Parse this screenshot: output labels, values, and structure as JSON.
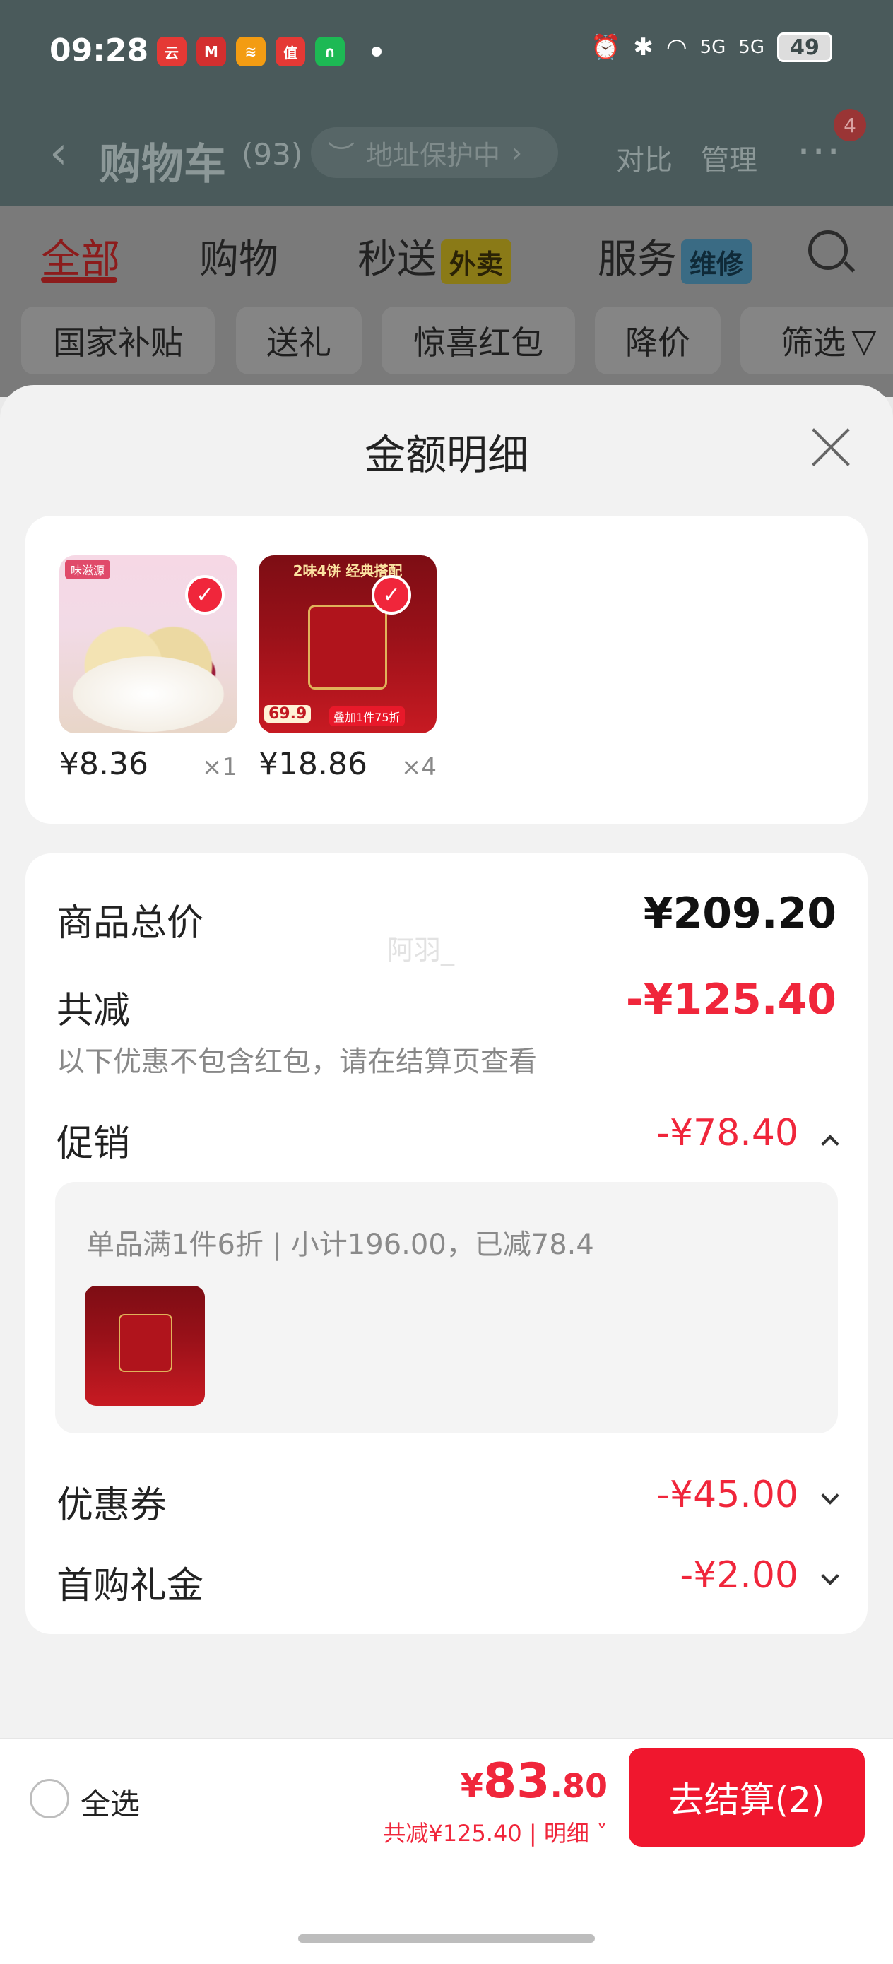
{
  "status_bar": {
    "time": "09:28",
    "apps": [
      {
        "icon": "yunshanfu-app-icon",
        "label": "云闪付",
        "color": "#e53935"
      },
      {
        "icon": "cmb-app-icon",
        "label": "M",
        "color": "#d32f2f"
      },
      {
        "icon": "pinduoduo-app-icon",
        "label": "≋",
        "color": "#f39c12"
      },
      {
        "icon": "smzdm-app-icon",
        "label": "值",
        "color": "#e53935"
      },
      {
        "icon": "fuli-app-icon",
        "label": "∩",
        "color": "#1db954"
      }
    ],
    "battery": "49",
    "network": "5G"
  },
  "navbar": {
    "back": "‹",
    "title": "购物车",
    "count": "(93)",
    "address_protect": "地址保护中",
    "compare": "对比",
    "manage": "管理",
    "more": "···",
    "badge": "4"
  },
  "tabs": [
    {
      "label": "全部",
      "active": true
    },
    {
      "label": "购物"
    },
    {
      "label": "秒送",
      "tag": "外卖",
      "tag_bg": "#8a7a17",
      "tag_color": "#2a2206"
    },
    {
      "label": "服务",
      "tag": "维修",
      "tag_bg": "#3a6b84",
      "tag_color": "#0f2a38"
    }
  ],
  "chips": [
    "国家补贴",
    "送礼",
    "惊喜红包",
    "降价",
    "筛选"
  ],
  "sheet": {
    "title": "金额明细",
    "products": [
      {
        "price": "¥8.36",
        "qty": "×1",
        "image_text": "味滋源"
      },
      {
        "price": "¥18.86",
        "qty": "×4",
        "image_text": "2味4饼 经典搭配",
        "sub_text": "叠加1件75折",
        "tag_price": "69.9"
      }
    ],
    "watermark": "阿羽_",
    "total_label": "商品总价",
    "total_value": "¥209.20",
    "reduce_label": "共减",
    "reduce_value": "-¥125.40",
    "reduce_note": "以下优惠不包含红包，请在结算页查看",
    "promo_label": "促销",
    "promo_value": "-¥78.40",
    "promo_detail": "单品满1件6折 | 小计196.00，已减78.4",
    "coupon_label": "优惠券",
    "coupon_value": "-¥45.00",
    "firstbuy_label": "首购礼金",
    "firstbuy_value": "-¥2.00"
  },
  "footer": {
    "select_all": "全选",
    "currency": "¥",
    "total_int": "83",
    "total_dec": ".80",
    "reduce_summary": "共减¥125.40 | 明细 ˅",
    "checkout": "去结算(2)"
  },
  "colors": {
    "accent_red": "#f0263b",
    "checkout_red": "#f0172e"
  }
}
